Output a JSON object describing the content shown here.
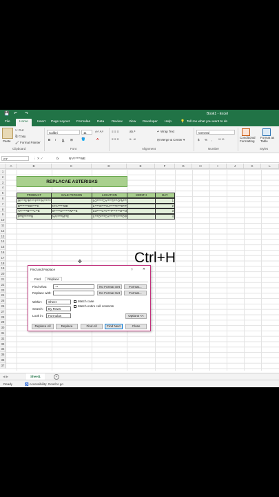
{
  "app": {
    "title": "Book1 - Excel",
    "qa_save": "💾",
    "qa_undo": "↶",
    "qa_redo": "↷"
  },
  "tabs": [
    "File",
    "Home",
    "Insert",
    "Page Layout",
    "Formulas",
    "Data",
    "Review",
    "View",
    "Developer",
    "Help"
  ],
  "tell_me": "Tell me what you want to do",
  "ribbon": {
    "clipboard": {
      "paste": "Paste",
      "cut": "Cut",
      "copy": "Copy",
      "format_painter": "Format Painter",
      "group": "Clipboard"
    },
    "font": {
      "name": "Calibri",
      "size": "11",
      "group": "Font",
      "bold": "B",
      "italic": "I",
      "underline": "U"
    },
    "alignment": {
      "wrap_text": "Wrap Text",
      "merge_center": "Merge & Center",
      "group": "Alignment"
    },
    "number": {
      "format": "General",
      "currency": "$",
      "percent": "%",
      "comma": ",",
      "group": "Number"
    },
    "styles": {
      "conditional": "Conditional Formatting",
      "format_table": "Format as Table",
      "group": "Styles"
    }
  },
  "formula_bar": {
    "name_box": "C7",
    "fx": "fx",
    "content": "N*A*****WE"
  },
  "columns": [
    "A",
    "B",
    "C",
    "D",
    "E",
    "F",
    "G",
    "H",
    "I",
    "J",
    "K",
    "L"
  ],
  "rows": [
    "1",
    "2",
    "3",
    "4",
    "5",
    "6",
    "7",
    "8",
    "9",
    "10",
    "11",
    "12",
    "13",
    "14",
    "15",
    "16",
    "17",
    "18",
    "19",
    "20",
    "21",
    "22",
    "23",
    "24",
    "25",
    "26",
    "27",
    "28",
    "29",
    "30",
    "31",
    "32",
    "33",
    "34",
    "35",
    "36",
    "37"
  ],
  "banner": "REPLACAE ASTERISKS",
  "table": {
    "headers": [
      "PRODUCT",
      "SALE PERSON",
      "LOCATION",
      "MONTH",
      "DAY"
    ],
    "rows": [
      [
        "M****E*R****I*****N*******AM****E",
        "",
        "LO*****CA****TI***O*N****US***US***T",
        "",
        "1"
      ],
      [
        "B*******OO****K",
        "N*A*****WE",
        "L****O****CA****TI***O*F****UN***E",
        "",
        "2"
      ],
      [
        "TA*****B****L**E",
        "B*****O******W***E",
        "LO****C*A***T***I***O**N***A***UARY",
        "",
        "3"
      ],
      [
        "P**E******N",
        "NA*****M**E",
        "L***O****CA****T*I****O*N****AP*RIL",
        "",
        "4"
      ]
    ]
  },
  "overlay_text": "Ctrl+H",
  "dialog": {
    "title": "Find and Replace",
    "help": "?",
    "close": "✕",
    "tab_find": "Find",
    "tab_replace": "Replace",
    "find_label": "Find what:",
    "find_value": "~*",
    "replace_label": "Replace with:",
    "replace_value": "",
    "no_format_1": "No Format Set",
    "no_format_2": "No Format Set",
    "format_1": "Format...",
    "format_2": "Format...",
    "within_label": "Within:",
    "within_value": "Sheet",
    "search_label": "Search:",
    "search_value": "By Rows",
    "lookin_label": "Look in:",
    "lookin_value": "Formulas",
    "match_case": "Match case",
    "match_entire": "Match entire cell contents",
    "options": "Options <<",
    "replace_all": "Replace All",
    "replace": "Replace",
    "find_all": "Find All",
    "find_next": "Find Next",
    "close_btn": "Close"
  },
  "sheet": {
    "name": "Sheet1",
    "add": "+"
  },
  "status": {
    "ready": "Ready",
    "accessibility": "Accessibility: Good to go"
  }
}
